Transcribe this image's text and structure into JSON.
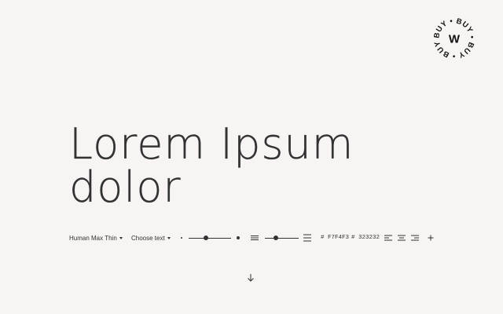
{
  "badge": {
    "ring_text": "BUY • BUY • BUY • BUY •",
    "letter": "W"
  },
  "specimen": {
    "line1": "Lorem Ipsum",
    "line2": "dolor"
  },
  "toolbar": {
    "font_label": "Human Max Thin",
    "text_label": "Choose text",
    "size_slider_value": 0.4,
    "leading_slider_value": 0.33,
    "bg_color": "# F7F4F3",
    "fg_color": "# 323232"
  },
  "colors": {
    "background": "#F7F4F3",
    "foreground": "#323232"
  }
}
